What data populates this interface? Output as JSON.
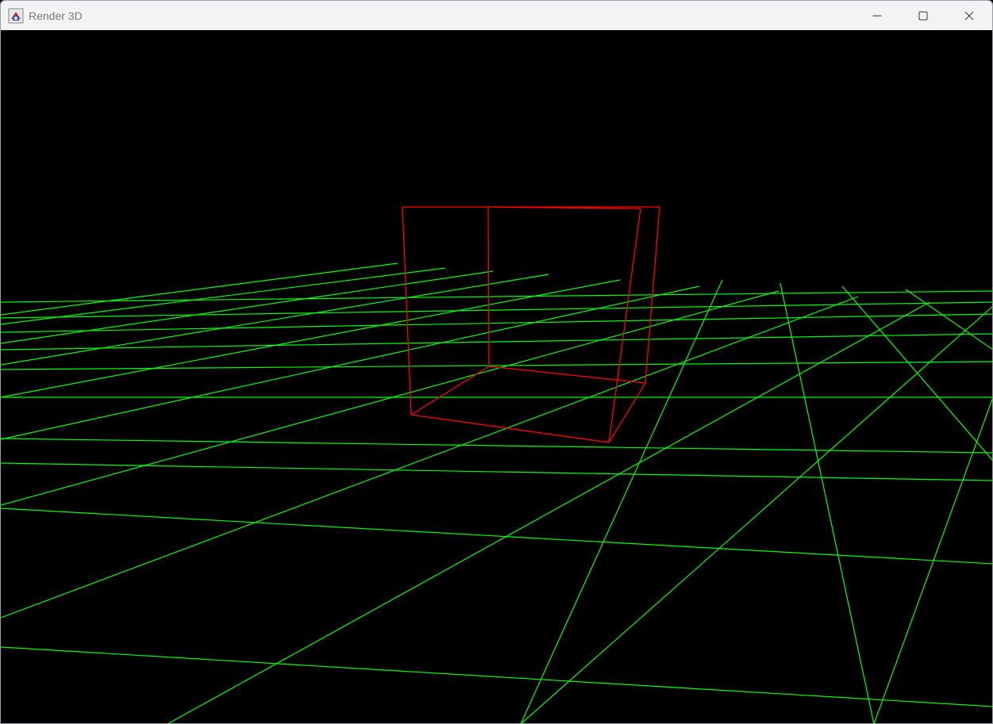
{
  "window": {
    "title": "Render 3D",
    "app_icon": "java-cup-icon"
  },
  "controls": {
    "minimize_icon": "minimize-icon",
    "maximize_icon": "maximize-icon",
    "close_icon": "close-icon"
  },
  "scene": {
    "background_color": "#000000",
    "grid_color": "#00ff00",
    "cube_color": "#ff0000",
    "grid_style": "wireframe-ground-plane",
    "cube_style": "wireframe"
  }
}
